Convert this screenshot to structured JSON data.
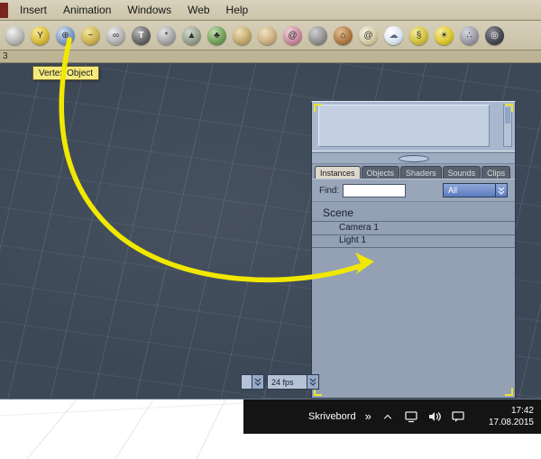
{
  "menubar": {
    "items": [
      {
        "label": "Insert"
      },
      {
        "label": "Animation"
      },
      {
        "label": "Windows"
      },
      {
        "label": "Web"
      },
      {
        "label": "Help"
      }
    ]
  },
  "toolbar": {
    "tools": [
      {
        "name": "sphere-primitive",
        "glyph": ""
      },
      {
        "name": "goblet-primitive",
        "glyph": "Y"
      },
      {
        "name": "vertex-object",
        "glyph": "⊕"
      },
      {
        "name": "spline-object",
        "glyph": "~"
      },
      {
        "name": "metaball-object",
        "glyph": "∞"
      },
      {
        "name": "text-object",
        "glyph": "T"
      },
      {
        "name": "particle-object",
        "glyph": "*"
      },
      {
        "name": "terrain-object",
        "glyph": "▲"
      },
      {
        "name": "plant-object",
        "glyph": "♣"
      },
      {
        "name": "dune-object",
        "glyph": ""
      },
      {
        "name": "hand-object",
        "glyph": ""
      },
      {
        "name": "shell-object",
        "glyph": "@"
      },
      {
        "name": "rock-object",
        "glyph": ""
      },
      {
        "name": "building-object",
        "glyph": "⌂"
      },
      {
        "name": "shell-object-2",
        "glyph": "@"
      },
      {
        "name": "cloud-object",
        "glyph": "☁"
      },
      {
        "name": "spring-object",
        "glyph": "§"
      },
      {
        "name": "sunburst-object",
        "glyph": "☀"
      },
      {
        "name": "particles-object",
        "glyph": "∴"
      },
      {
        "name": "target-object",
        "glyph": "◎"
      }
    ]
  },
  "tab_strip": {
    "label": "3"
  },
  "tooltip": {
    "text": "Vertex Object"
  },
  "panel": {
    "tabs": [
      {
        "label": "Instances",
        "active": true
      },
      {
        "label": "Objects",
        "active": false
      },
      {
        "label": "Shaders",
        "active": false
      },
      {
        "label": "Sounds",
        "active": false
      },
      {
        "label": "Clips",
        "active": false
      }
    ],
    "find": {
      "label": "Find:",
      "value": "",
      "filter_value": "All"
    },
    "scene_tree": {
      "root_label": "Scene",
      "items": [
        {
          "label": "Camera 1"
        },
        {
          "label": "Light 1"
        }
      ]
    }
  },
  "viewport_controls": {
    "fps_value": "24 fps"
  },
  "taskbar": {
    "desktop_label": "Skrivebord",
    "overflow_chevron": "»",
    "time": "17:42",
    "date": "17.08.2015"
  },
  "colors": {
    "accent_arrow": "#f0e800",
    "tooltip_bg": "#f5e97e",
    "viewport_bg": "#3d4857",
    "ui_tan": "#cfc8ad",
    "panel_bg": "#94a0b4",
    "taskbar_bg": "#141414",
    "dropdown_blue": "#5c7cc0"
  }
}
